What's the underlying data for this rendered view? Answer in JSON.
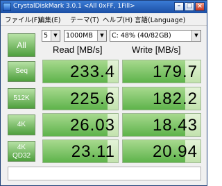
{
  "window": {
    "title": "CrystalDiskMark 3.0.1  <All 0xFF, 1Fill>"
  },
  "menu": [
    "ファイル(F)",
    "編集(E)",
    "テーマ(T)",
    "ヘルプ(H)",
    "言語(Language)"
  ],
  "controls": {
    "all_label": "All",
    "count": "5",
    "size": "1000MB",
    "drive": "C: 48% (40/82GB)"
  },
  "headers": {
    "read": "Read [MB/s]",
    "write": "Write [MB/s]"
  },
  "tests": [
    {
      "label1": "Seq",
      "label2": "",
      "read": "233.4",
      "write": "179.7",
      "read_fill": 0.86,
      "write_fill": 0.8
    },
    {
      "label1": "512K",
      "label2": "",
      "read": "225.6",
      "write": "182.2",
      "read_fill": 0.86,
      "write_fill": 0.8
    },
    {
      "label1": "4K",
      "label2": "",
      "read": "26.03",
      "write": "18.43",
      "read_fill": 0.86,
      "write_fill": 0.8
    },
    {
      "label1": "4K",
      "label2": "QD32",
      "read": "23.11",
      "write": "20.94",
      "read_fill": 0.86,
      "write_fill": 0.8
    }
  ],
  "colors": {
    "accent_green": "#4e9f3d",
    "cell_bg": "#c2e2ad",
    "title_blue": "#1c4fa4"
  },
  "icons": {
    "app": "disk-icon",
    "minimize": "minimize-icon",
    "maximize": "maximize-icon",
    "close": "close-icon",
    "dropdown": "chevron-down-icon"
  }
}
